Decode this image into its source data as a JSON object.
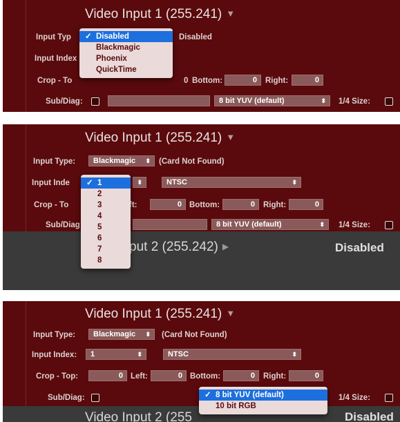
{
  "panel1": {
    "title": "Video Input 1 (255.241)",
    "labels": {
      "input_type": "Input Typ",
      "input_index": "Input Index",
      "crop": "Crop - To",
      "sub_diag": "Sub/Diag:"
    },
    "status": "Disabled",
    "crop_values": {
      "bottom_label": "Bottom:",
      "bottom": "0",
      "right_label": "Right:",
      "right": "0",
      "left_value": "0"
    },
    "format_popup": "8 bit YUV (default)",
    "quarter_size_label": "1/4 Size:",
    "menu": {
      "items": [
        "Disabled",
        "Blackmagic",
        "Phoenix",
        "QuickTime"
      ],
      "selected_index": 0
    }
  },
  "panel2": {
    "title": "Video Input 1 (255.241)",
    "labels": {
      "input_type": "Input Type:",
      "input_index": "Input Inde",
      "crop": "Crop - To",
      "sub_diag": "Sub/Diag"
    },
    "input_type_value": "Blackmagic",
    "card_status": "(Card Not Found)",
    "standard": "NTSC",
    "crop_values": {
      "left_label": "ft:",
      "left": "0",
      "bottom_label": "Bottom:",
      "bottom": "0",
      "right_label": "Right:",
      "right": "0"
    },
    "format_popup": "8 bit YUV (default)",
    "quarter_size_label": "1/4 Size:",
    "menu": {
      "items": [
        "1",
        "2",
        "3",
        "4",
        "5",
        "6",
        "7",
        "8"
      ],
      "selected_index": 0
    },
    "input2_title": "put 2 (255.242)",
    "input2_status": "Disabled"
  },
  "panel3": {
    "title": "Video Input 1 (255.241)",
    "labels": {
      "input_type": "Input Type:",
      "input_index": "Input Index:",
      "crop": "Crop - Top:",
      "sub_diag": "Sub/Diag:"
    },
    "input_type_value": "Blackmagic",
    "card_status": "(Card Not Found)",
    "index_value": "1",
    "standard": "NTSC",
    "crop_values": {
      "top": "0",
      "left_label": "Left:",
      "left": "0",
      "bottom_label": "Bottom:",
      "bottom": "0",
      "right_label": "Right:",
      "right": "0"
    },
    "quarter_size_label": "1/4 Size:",
    "menu": {
      "items": [
        "8 bit YUV (default)",
        "10 bit RGB"
      ],
      "selected_index": 0
    },
    "input2_title": "Video Input 2 (255",
    "input2_status": "Disabled"
  },
  "icons": {
    "check": "checkmark-icon",
    "stepper": "stepper-arrows-icon",
    "disclosure": "disclosure-triangle-icon"
  },
  "colors": {
    "panel_bg": "#5a0a0c",
    "selection": "#1d6fde",
    "menu_bg": "#eadada",
    "gray_bar": "#3a3a3a"
  }
}
